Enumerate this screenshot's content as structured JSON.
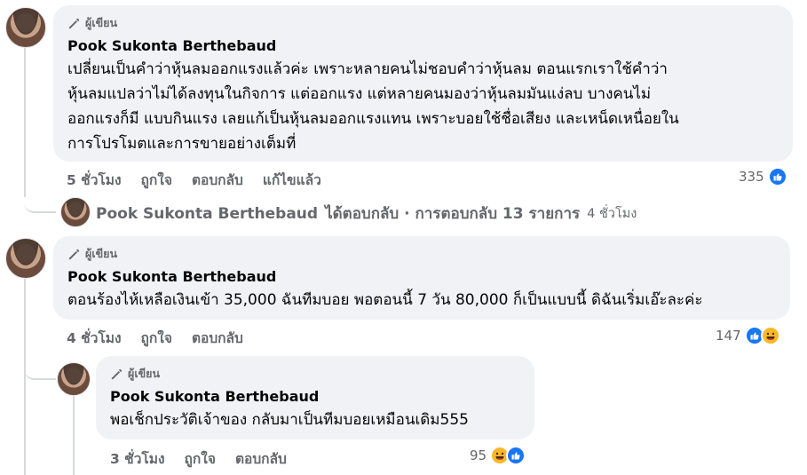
{
  "comments": [
    {
      "badge": "ผู้เขียน",
      "author": "Pook Sukonta Berthebaud",
      "text": "เปลี่ยนเป็นคำว่าหุ้นลมออกแรงแล้วค่ะ เพราะหลายคนไม่ชอบคำว่าหุ้นลม ตอนแรกเราใช้คำว่า\nหุ้นลมแปลว่าไม่ได้ลงทุนในกิจการ แต่ออกแรง แต่หลายคนมองว่าหุ้นลมมันแง่ลบ บางคนไม่\nออกแรงก็มี แบบกินแรง เลยแก้เป็นหุ้นลมออกแรงแทน เพราะบอยใช้ชื่อเสียง และเหน็ดเหนื่อยใน\nการโปรโมตและการขายอย่างเต็มที่",
      "time": "5 ชั่วโมง",
      "like": "ถูกใจ",
      "reply": "ตอบกลับ",
      "edited": "แก้ไขแล้ว",
      "reaction_count": "335",
      "reactions": [
        "like-icon"
      ],
      "reply_summary": {
        "name": "Pook Sukonta Berthebaud",
        "text": "ได้ตอบกลับ · การตอบกลับ 13 รายการ",
        "time": "4 ชั่วโมง"
      }
    },
    {
      "badge": "ผู้เขียน",
      "author": "Pook Sukonta Berthebaud",
      "text": "ตอนร้องไห้เหลือเงินเข้า 35,000 ฉันทีมบอย พอตอนนี้ 7 วัน 80,000 ก็เป็นแบบนี้ ดิฉันเริ่มเอ๊ะละค่ะ",
      "time": "4 ชั่วโมง",
      "like": "ถูกใจ",
      "reply": "ตอบกลับ",
      "reaction_count": "147",
      "reactions": [
        "like-icon",
        "haha-icon"
      ]
    },
    {
      "badge": "ผู้เขียน",
      "author": "Pook Sukonta Berthebaud",
      "text": "พอเช็กประวัติเจ้าของ กลับมาเป็นทีมบอยเหมือนเดิม555",
      "time": "3 ชั่วโมง",
      "like": "ถูกใจ",
      "reply": "ตอบกลับ",
      "reaction_count": "95",
      "reactions": [
        "haha-icon",
        "like-icon"
      ]
    }
  ],
  "colors": {
    "bubble": "#f0f2f5",
    "muted": "#65676b",
    "like": "#1877f2",
    "haha": "#f7b928"
  }
}
